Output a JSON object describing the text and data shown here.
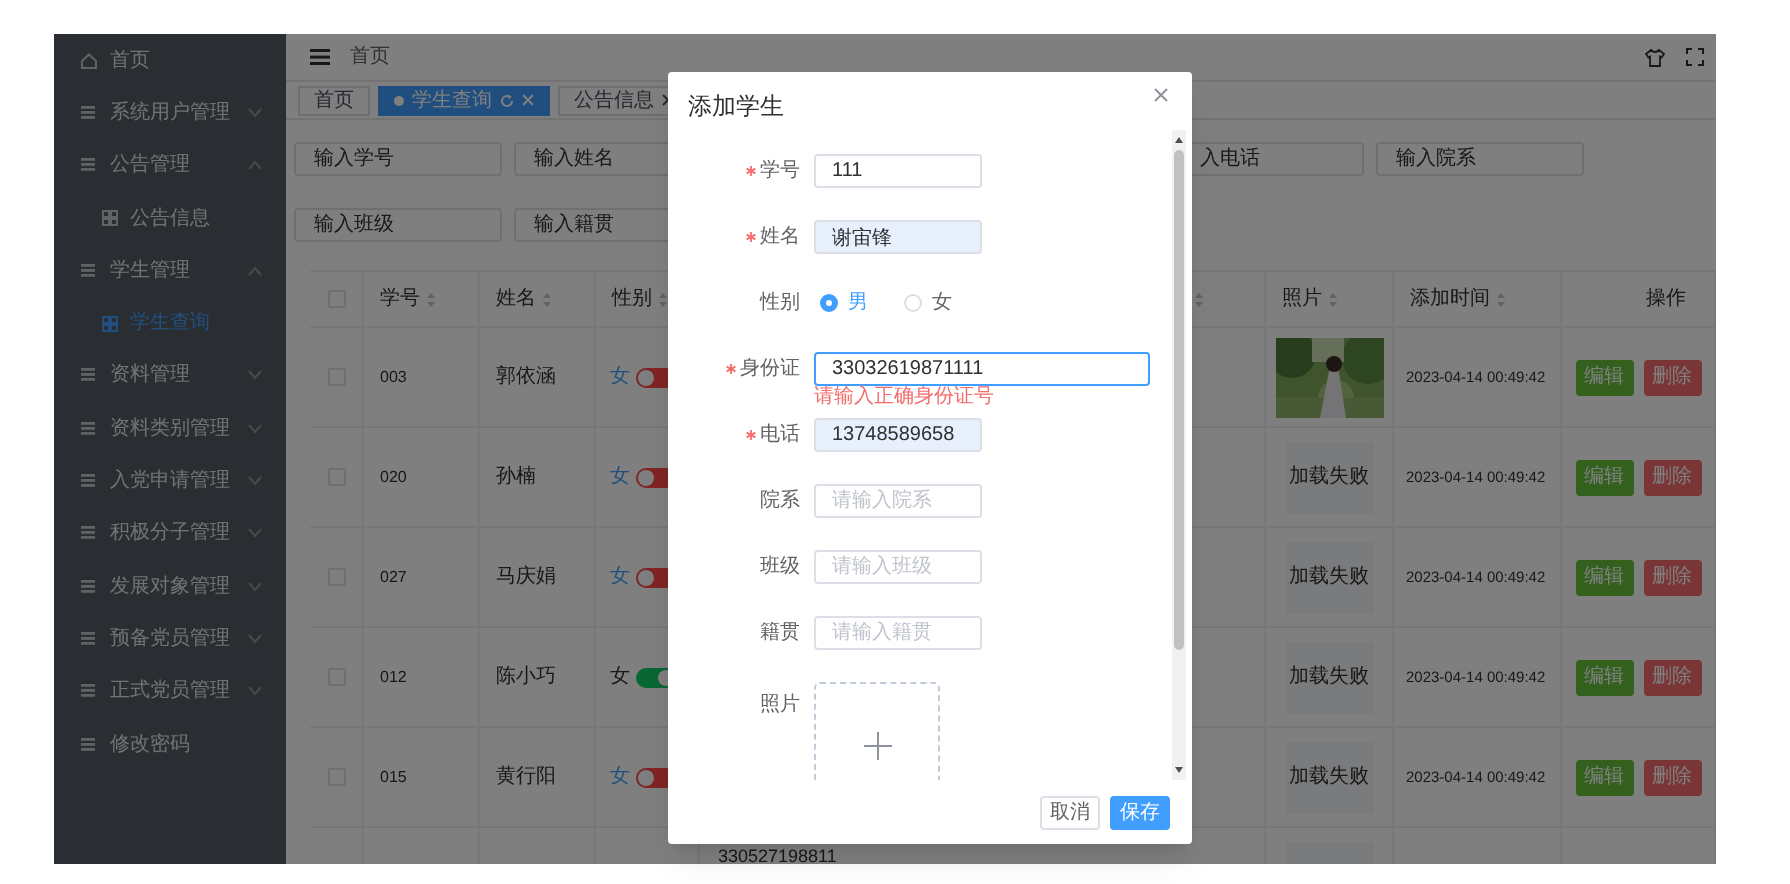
{
  "sidebar": {
    "items": [
      {
        "kind": "home",
        "label": "首页",
        "selected": false
      },
      {
        "kind": "submenu",
        "label": "系统用户管理",
        "selected": false,
        "expanded": false
      },
      {
        "kind": "submenu",
        "label": "公告管理",
        "selected": false,
        "expanded": true,
        "children": [
          {
            "label": "公告信息",
            "selected": false
          }
        ]
      },
      {
        "kind": "submenu",
        "label": "学生管理",
        "selected": false,
        "expanded": true,
        "children": [
          {
            "label": "学生查询",
            "selected": true
          }
        ]
      },
      {
        "kind": "submenu",
        "label": "资料管理",
        "selected": false,
        "expanded": false
      },
      {
        "kind": "submenu",
        "label": "资料类别管理",
        "selected": false,
        "expanded": false
      },
      {
        "kind": "submenu",
        "label": "入党申请管理",
        "selected": false,
        "expanded": false
      },
      {
        "kind": "submenu",
        "label": "积极分子管理",
        "selected": false,
        "expanded": false
      },
      {
        "kind": "submenu",
        "label": "发展对象管理",
        "selected": false,
        "expanded": false
      },
      {
        "kind": "submenu",
        "label": "预备党员管理",
        "selected": false,
        "expanded": false
      },
      {
        "kind": "submenu",
        "label": "正式党员管理",
        "selected": false,
        "expanded": false
      },
      {
        "kind": "link",
        "label": "修改密码",
        "selected": false
      }
    ]
  },
  "header": {
    "breadcrumb": "首页"
  },
  "tabs": [
    {
      "label": "首页",
      "selected": false,
      "closable": false
    },
    {
      "label": "学生查询",
      "selected": true,
      "closable": true
    },
    {
      "label": "公告信息",
      "selected": false,
      "closable": true
    }
  ],
  "filters": [
    [
      {
        "kind": "field",
        "placeholder": "输入学号"
      },
      {
        "kind": "field",
        "placeholder": "输入姓名"
      },
      {
        "kind": "cut_field",
        "placeholder": "入电话"
      },
      {
        "kind": "field",
        "placeholder": "输入院系"
      }
    ],
    [
      {
        "kind": "field",
        "placeholder": "输入班级"
      },
      {
        "kind": "field",
        "placeholder": "输入籍贯"
      }
    ]
  ],
  "table": {
    "select_all": {
      "checked": false
    },
    "columns": [
      {
        "label": "学号",
        "sortable": true
      },
      {
        "label": "姓名",
        "sortable": true
      },
      {
        "label": "性别",
        "sortable": true
      },
      {
        "sortable": true
      },
      {
        "label": "照片",
        "sortable": true
      },
      {
        "label": "添加时间",
        "sortable": true
      },
      {
        "label": "操作",
        "sortable": false
      }
    ],
    "rows": [
      {
        "kind": "full",
        "checked": false,
        "id": "003",
        "name": "郭依涵",
        "gender": "女",
        "enabled": false,
        "photo": {
          "kind": "picture"
        },
        "time": "2023-04-14 00:49:42",
        "actions": [
          "编辑",
          "删除"
        ]
      },
      {
        "kind": "full",
        "checked": false,
        "id": "020",
        "name": "孙楠",
        "gender": "女",
        "enabled": false,
        "photo": {
          "kind": "failed",
          "text": "加载失败"
        },
        "time": "2023-04-14 00:49:42",
        "actions": [
          "编辑",
          "删除"
        ]
      },
      {
        "kind": "full",
        "checked": false,
        "id": "027",
        "name": "马庆娟",
        "gender": "女",
        "enabled": false,
        "photo": {
          "kind": "failed",
          "text": "加载失败"
        },
        "time": "2023-04-14 00:49:42",
        "actions": [
          "编辑",
          "删除"
        ]
      },
      {
        "kind": "full",
        "checked": false,
        "id": "012",
        "name": "陈小巧",
        "gender": "女",
        "enabled": true,
        "photo": {
          "kind": "failed",
          "text": "加载失败"
        },
        "time": "2023-04-14 00:49:42",
        "actions": [
          "编辑",
          "删除"
        ]
      },
      {
        "kind": "full",
        "checked": false,
        "id": "015",
        "name": "黄行阳",
        "gender": "女",
        "enabled": false,
        "photo": {
          "kind": "failed",
          "text": "加载失败"
        },
        "time": "2023-04-14 00:49:42",
        "actions": [
          "编辑",
          "删除"
        ]
      },
      {
        "kind": "partial",
        "id_number": "330527198811",
        "photo": {
          "kind": "blank"
        }
      }
    ]
  },
  "dialog": {
    "title": "添加学生",
    "fields": [
      {
        "kind": "text",
        "label": "学号",
        "required": true,
        "value": "111",
        "autofilled": false,
        "focused": false
      },
      {
        "kind": "text",
        "label": "姓名",
        "required": true,
        "value": "谢宙锋",
        "autofilled": true,
        "focused": false
      },
      {
        "kind": "radio",
        "label": "性别",
        "required": false,
        "options": [
          {
            "label": "男",
            "selected": true
          },
          {
            "label": "女",
            "selected": false
          }
        ]
      },
      {
        "kind": "long_text",
        "label": "身份证",
        "required": true,
        "value": "33032619871111",
        "autofilled": false,
        "focused": true,
        "error": "请输入正确身份证号"
      },
      {
        "kind": "text",
        "label": "电话",
        "required": true,
        "value": "13748589658",
        "autofilled": true,
        "focused": false
      },
      {
        "kind": "text",
        "label": "院系",
        "required": false,
        "placeholder": "请输入院系",
        "autofilled": false,
        "focused": false
      },
      {
        "kind": "text",
        "label": "班级",
        "required": false,
        "placeholder": "请输入班级",
        "autofilled": false,
        "focused": false
      },
      {
        "kind": "text",
        "label": "籍贯",
        "required": false,
        "placeholder": "请输入籍贯",
        "autofilled": false,
        "focused": false
      },
      {
        "kind": "upload",
        "label": "照片",
        "required": false
      }
    ],
    "buttons": [
      {
        "label": "取消",
        "primary": false
      },
      {
        "label": "保存",
        "primary": true
      }
    ]
  }
}
